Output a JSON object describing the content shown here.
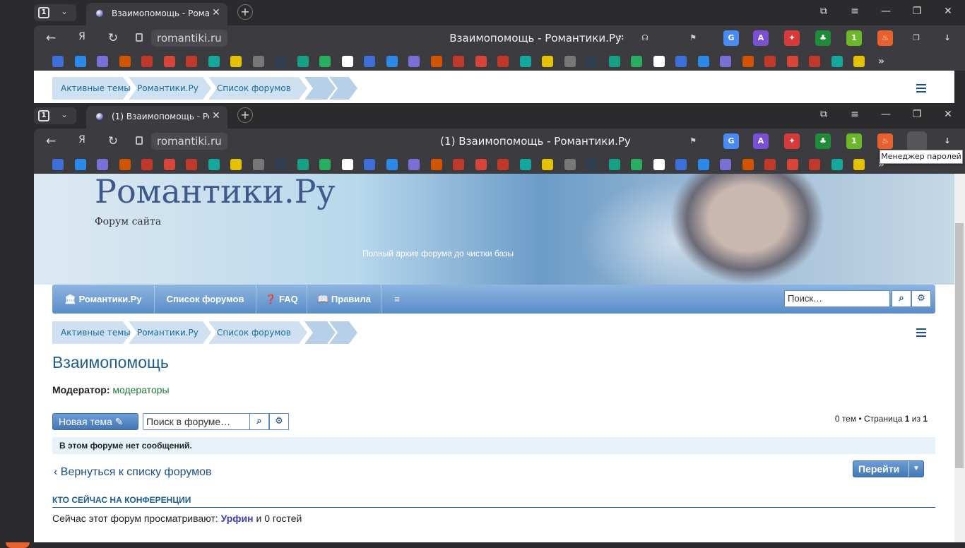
{
  "browser": {
    "tab_count": "1",
    "tab_title_top": "Взаимопомощь - Романтики.Ру",
    "tab_title_bottom": "(1) Взаимопомощь - Романтики.Ру",
    "url_host": "romantiki.ru",
    "page_title_top": "Взаимопомощь - Романтики.Ру",
    "page_title_bottom": "(1) Взаимопомощь - Романтики.Ру",
    "tooltip": "Менеджер паролей",
    "yandex_glyph": "Я",
    "more_glyph": "»",
    "bookmarks": [
      "VK",
      "A",
      "R",
      "МИР МК",
      "K",
      "R",
      "R",
      "R",
      "B",
      "T",
      "M",
      "WB"
    ]
  },
  "site": {
    "name": "Романтики.Ру",
    "description": "Форум сайта",
    "archive_note": "Полный архив форума до чистки базы",
    "nav": [
      "Романтики.Ру",
      "Список форумов",
      "FAQ",
      "Правила"
    ],
    "search_placeholder": "Поиск…"
  },
  "breadcrumbs": [
    "Активные темы",
    "Романтики.Ру",
    "Список форумов"
  ],
  "forum": {
    "title": "Взаимопомощь",
    "moderator_label": "Модератор:",
    "moderator_value": "модераторы",
    "new_topic": "Новая тема",
    "forum_search_placeholder": "Поиск в форуме…",
    "pagination": {
      "prefix": "0 тем • Страница",
      "page": "1",
      "of": "из",
      "total": "1"
    },
    "empty_notice": "В этом форуме нет сообщений.",
    "back_link": "Вернуться к списку форумов",
    "jump": "Перейти",
    "online_header": "КТО СЕЙЧАС НА КОНФЕРЕНЦИИ",
    "online_prefix": "Сейчас этот форум просматривают:",
    "online_user": "Урфин",
    "online_suffix": "и 0 гостей"
  },
  "colors": {
    "brand": "#5b8dc8",
    "title": "#1b5e8f",
    "link": "#1b4f85",
    "notice_bg": "#e7f2fb"
  }
}
